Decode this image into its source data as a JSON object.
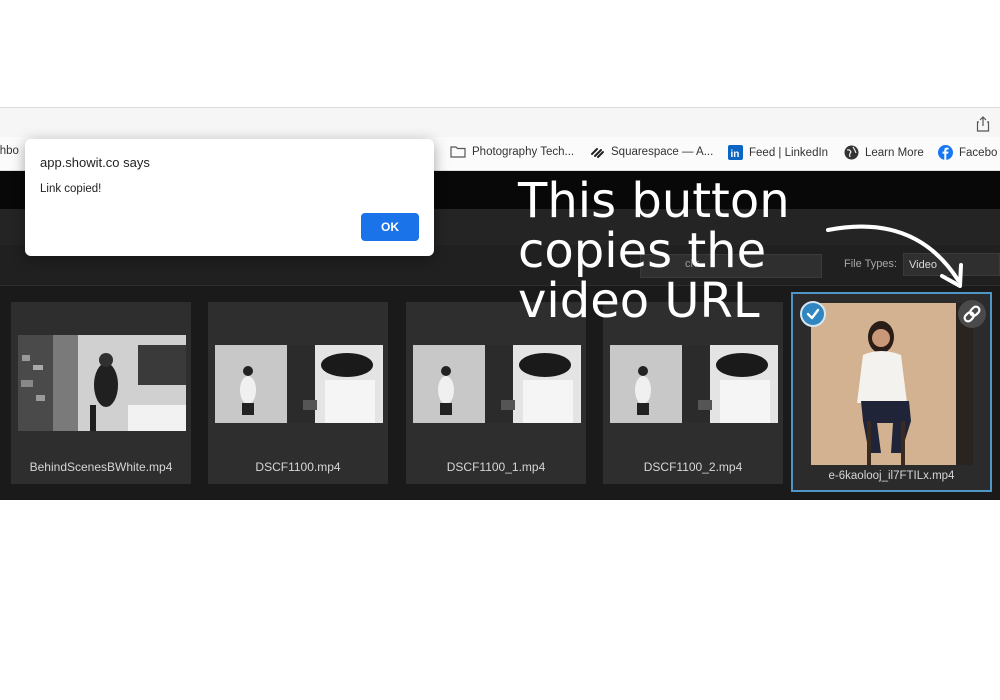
{
  "bookmarks": [
    {
      "label": "shbo",
      "icon": "dashboard-icon"
    },
    {
      "label": "Photography Tech...",
      "icon": "folder-icon"
    },
    {
      "label": "Squarespace — A...",
      "icon": "squarespace-icon"
    },
    {
      "label": "Feed | LinkedIn",
      "icon": "linkedin-icon"
    },
    {
      "label": "Learn More",
      "icon": "globe-icon"
    },
    {
      "label": "Facebo",
      "icon": "facebook-icon"
    }
  ],
  "dialog": {
    "title": "app.showit.co says",
    "message": "Link copied!",
    "ok_label": "OK"
  },
  "filters": {
    "search_label": "ch:",
    "file_types_label": "File Types:",
    "file_types_value": "Video"
  },
  "tiles": [
    {
      "name": "BehindScenesBWhite.mp4"
    },
    {
      "name": "DSCF1100.mp4"
    },
    {
      "name": "DSCF1100_1.mp4"
    },
    {
      "name": "DSCF1100_2.mp4"
    },
    {
      "name": "e-6kaolooj_il7FTILx.mp4",
      "selected": true
    }
  ],
  "annotation": {
    "line1": "This button",
    "line2": "copies the",
    "line3": "video URL"
  },
  "colors": {
    "accent_blue": "#1a73e8",
    "selection_blue": "#4f95c8",
    "dark_bg": "#1a1a1a"
  }
}
